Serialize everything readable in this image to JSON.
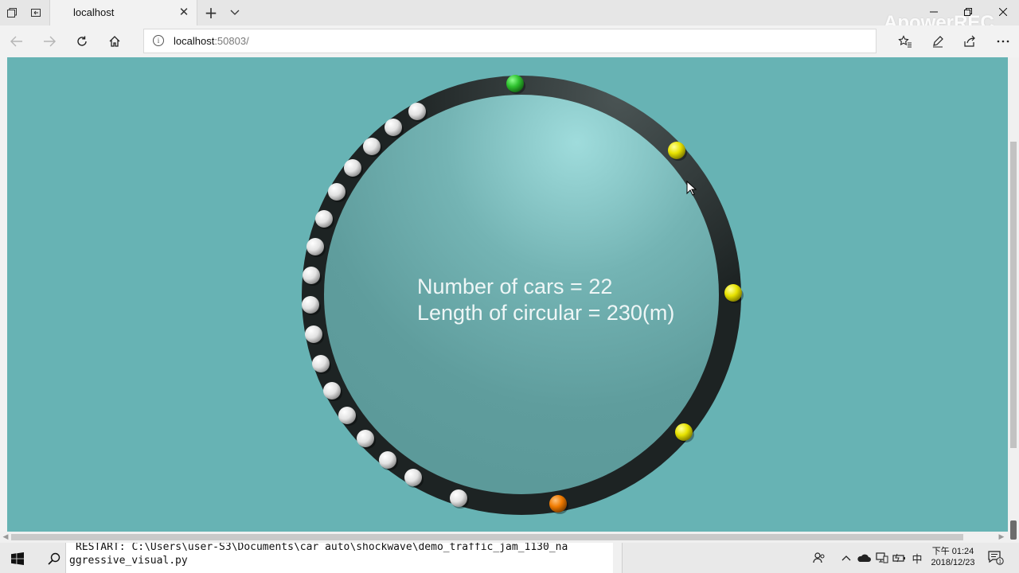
{
  "browser": {
    "tab_title": "localhost",
    "tab_close": "✕",
    "new_tab": "+",
    "url_host": "localhost",
    "url_port": ":50803/",
    "watermark": "ApowerREC"
  },
  "page": {
    "line1": "Number of cars = 22",
    "line2": "Length of circular = 230(m)",
    "background_color": "#67b3b4",
    "track_color": "#1d2323",
    "car_colors": {
      "default": "#f2f2f2",
      "leader": "#2ec22e",
      "highlight": "#e7e200",
      "brake": "#ef7a00"
    },
    "cars": {
      "total": 22,
      "white": 17,
      "green": 1,
      "yellow": 3,
      "orange": 1
    }
  },
  "console": {
    "line1": "RESTART: C:\\Users\\user-S3\\Documents\\car auto\\shockwave\\demo_traffic_jam_1130_na",
    "line2": "ggressive_visual.py"
  },
  "taskbar": {
    "ime": "中",
    "time": "下午 01:24",
    "date": "2018/12/23",
    "notification_count": "1"
  }
}
